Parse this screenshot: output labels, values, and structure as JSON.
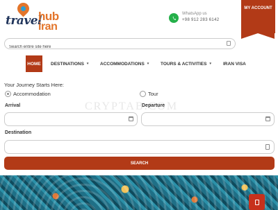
{
  "header": {
    "logo_travel": "travel",
    "logo_hub": "hub",
    "logo_iran": "iran",
    "whatsapp_label": "WhatsApp us",
    "whatsapp_phone": "+98 912 283 6142",
    "account_label": "MY ACCOUNT"
  },
  "search": {
    "placeholder": "Search entire site here"
  },
  "nav": {
    "items": [
      {
        "label": "HOME",
        "active": true
      },
      {
        "label": "DESTINATIONS",
        "caret": "▾"
      },
      {
        "label": "ACCOMMODATIONS",
        "caret": "▾"
      },
      {
        "label": "TOURS & ACTIVITIES",
        "caret": "▾"
      },
      {
        "label": "IRAN VISA"
      }
    ]
  },
  "form": {
    "title": "Your Journey Starts Here:",
    "options": [
      {
        "label": "Accommodation",
        "selected": true
      },
      {
        "label": "Tour",
        "selected": false
      }
    ],
    "arrival_label": "Arrival",
    "departure_label": "Departure",
    "destination_label": "Destination",
    "search_button": "SEARCH"
  },
  "watermark": "CRYPTAB.COM",
  "colors": {
    "accent": "#b23a17",
    "logo_blue": "#22365c",
    "logo_orange": "#e3752b",
    "whatsapp_green": "#25b04a"
  },
  "icons": {
    "whatsapp": "whatsapp-icon",
    "search": "search-icon",
    "calendar": "calendar-icon",
    "destination": "location-icon",
    "scroll_top": "scroll-top-icon"
  }
}
